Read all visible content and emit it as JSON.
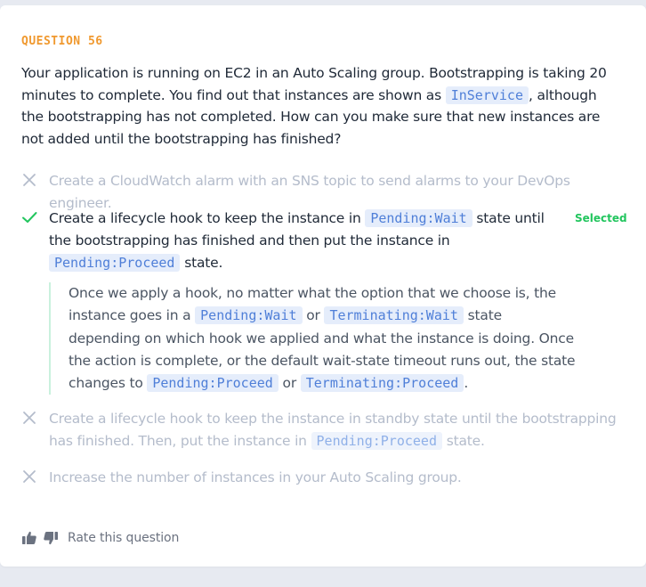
{
  "question": {
    "label": "QUESTION 56",
    "text_1": "Your application is running on EC2 in an Auto Scaling group. Bootstrapping is taking 20 minutes to complete. You find out that instances are shown as ",
    "code_1": "InService",
    "text_2": ", although the bootstrapping has not completed. How can you make sure that new instances are not added until the bootstrapping has finished?"
  },
  "options": [
    {
      "text": "Create a CloudWatch alarm with an SNS topic to send alarms to your DevOps engineer.",
      "state": "wrong"
    },
    {
      "text_1": "Create a lifecycle hook to keep the instance in ",
      "code_1": "Pending:Wait",
      "text_2": " state until the bootstrapping has finished and then put the instance in ",
      "code_2": "Pending:Proceed",
      "text_3": " state.",
      "badge": "Selected",
      "state": "correct"
    },
    {
      "text_1": "Create a lifecycle hook to keep the instance in standby state until the bootstrapping has finished. Then, put the instance in ",
      "code_1": "Pending:Proceed",
      "text_2": " state.",
      "state": "wrong"
    },
    {
      "text": "Increase the number of instances in your Auto Scaling group.",
      "state": "wrong"
    }
  ],
  "explanation": {
    "text_1": "Once we apply a hook, no matter what the option that we choose is, the instance goes in a ",
    "code_1": "Pending:Wait",
    "text_2": " or ",
    "code_2": "Terminating:Wait",
    "text_3": " state depending on which hook we applied and what the instance is doing. Once the action is complete, or the default wait-state timeout runs out, the state changes to ",
    "code_3": "Pending:Proceed",
    "text_4": " or ",
    "code_4": "Terminating:Proceed",
    "text_5": "."
  },
  "footer": {
    "rate_label": "Rate this question",
    "thumbs_up_icon": "thumbs-up-icon",
    "thumbs_down_icon": "thumbs-down-icon"
  },
  "colors": {
    "accent_orange": "#f0992f",
    "correct_green": "#22c55e",
    "code_blue": "#4f7fd8",
    "wrong_gray": "#b4bccb"
  }
}
